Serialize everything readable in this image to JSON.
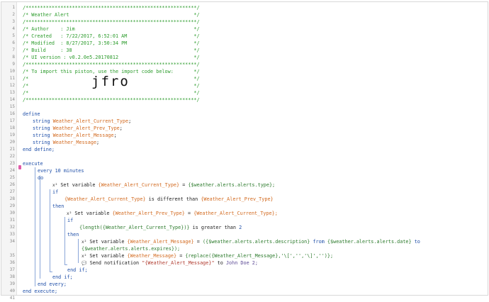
{
  "line_numbers": [
    "1",
    "2",
    "3",
    "4",
    "5",
    "6",
    "7",
    "8",
    "9",
    "10",
    "11",
    "12",
    "13",
    "14",
    "15",
    "16",
    "17",
    "18",
    "19",
    "20",
    "21",
    "22",
    "23",
    "24",
    "25",
    "26",
    "27",
    "28",
    "29",
    "30",
    "31",
    "32",
    "33",
    "34",
    "35",
    "36",
    "37",
    "38",
    "39",
    "40",
    "41"
  ],
  "header": {
    "l1": "/***********************************************************/",
    "l2": "/* Weather Alert                                           */",
    "l3": "/***********************************************************/",
    "l4": "/* Author    : Jim                                         */",
    "l5": "/* Created   : 7/22/2017, 6:52:01 AM                       */",
    "l6": "/* Modified  : 8/27/2017, 3:50:34 PM                       */",
    "l7": "/* Build     : 38                                          */",
    "l8": "/* UI version : v0.2.0e5.20170812                          */",
    "l9": "/***********************************************************/",
    "l10": "/* To import this piston, use the import code below:       */",
    "l11": "/*                                                         */",
    "l12": "/*                                                         */",
    "l13": "/*                                                         */",
    "l14": "/***********************************************************/"
  },
  "import_code": "jfro",
  "define": {
    "open": "define",
    "vars": [
      {
        "type": "string",
        "name": "Weather_Alert_Current_Type"
      },
      {
        "type": "string",
        "name": "Weather_Alert_Prev_Type"
      },
      {
        "type": "string",
        "name": "Weather_Alert_Message"
      },
      {
        "type": "string",
        "name": "Weather_Message"
      }
    ],
    "close": "end define;"
  },
  "execute": {
    "open": "execute",
    "every": "every",
    "every_value": "10 minutes",
    "do": "do",
    "set1_label": "Set variable",
    "set1_var": "{Weather_Alert_Current_Type}",
    "set1_eq": "=",
    "set1_val": "{$weather.alerts.alerts.type};",
    "if1": "if",
    "cond1_a": "{Weather_Alert_Current_Type}",
    "cond1_op": "is different than",
    "cond1_b": "{Weather_Alert_Prev_Type}",
    "then1": "then",
    "set2_label": "Set variable",
    "set2_var": "{Weather_Alert_Prev_Type}",
    "set2_eq": "=",
    "set2_val": "{Weather_Alert_Current_Type};",
    "if2": "if",
    "cond2_a": "{length({Weather_Alert_Current_Type})}",
    "cond2_op": "is greater than",
    "cond2_b": "2",
    "then2": "then",
    "set3_label": "Set variable",
    "set3_var": "{Weather_Alert_Message}",
    "set3_eq": "=",
    "set3_val": "({$weather.alerts.alerts.description}",
    "set3_from": "from",
    "set3_val2": "{$weather.alerts.alerts.date}",
    "set3_to": "to",
    "set3_cont": "{$weather.alerts.alerts.expires});",
    "set4_label": "Set variable",
    "set4_var": "{Weather_Message}",
    "set4_eq": "=",
    "set4_val": "{replace({Weather_Alert_Message},'\\[','','\\]','')};",
    "notify_label": "Send notification",
    "notify_msg": "\"{Weather_Alert_Message}\"",
    "notify_to": "to",
    "notify_who": "John Doe 2;",
    "endif2": "end if;",
    "endif1": "end if;",
    "endevery": "end every;",
    "close": "end execute;"
  }
}
